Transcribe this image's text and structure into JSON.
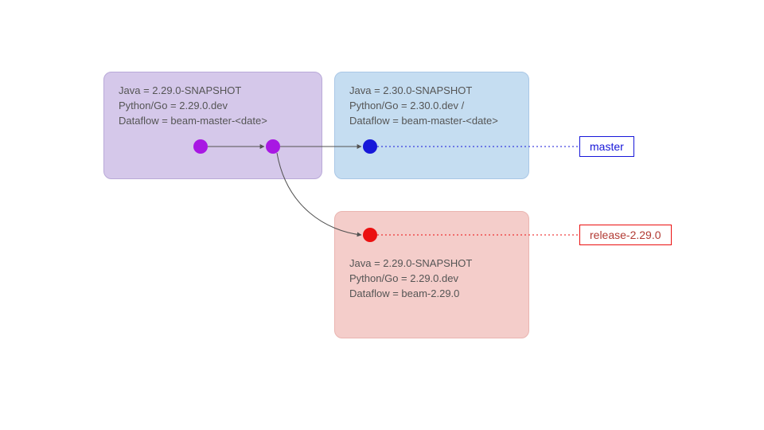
{
  "purpleBox": {
    "java": "Java = 2.29.0-SNAPSHOT",
    "pygo": "Python/Go = 2.29.0.dev",
    "df": "Dataflow = beam-master-<date>"
  },
  "blueBox": {
    "java": "Java = 2.30.0-SNAPSHOT",
    "pygo": "Python/Go = 2.30.0.dev /",
    "df": "Dataflow = beam-master-<date>"
  },
  "redBox": {
    "java": "Java = 2.29.0-SNAPSHOT",
    "pygo": "Python/Go = 2.29.0.dev",
    "df": "Dataflow = beam-2.29.0"
  },
  "labels": {
    "master": "master",
    "release": "release-2.29.0"
  },
  "colors": {
    "purpleFill": "#d5c8ea",
    "blueFill": "#c5ddf1",
    "redFill": "#f4cdca",
    "purpleDot": "#a818e3",
    "blueDot": "#1717d9",
    "redDot": "#eb1010",
    "arrow": "#525252"
  }
}
